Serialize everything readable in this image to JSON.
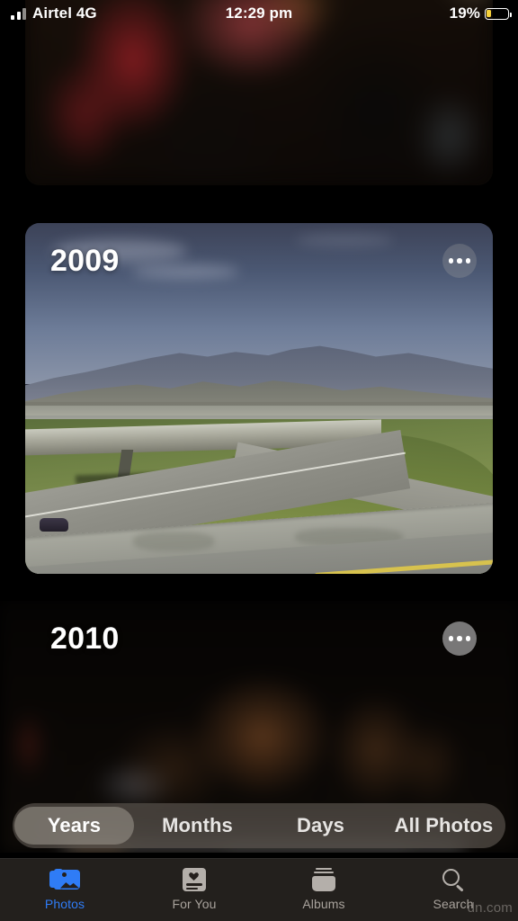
{
  "status_bar": {
    "carrier": "Airtel 4G",
    "time": "12:29 pm",
    "battery_percent": "19%",
    "battery_level": 19,
    "signal_icon": "signal-bars-icon",
    "battery_icon": "battery-low-icon",
    "battery_color": "#f7d13a"
  },
  "app": {
    "name": "Photos",
    "screen": "Years"
  },
  "cards": [
    {
      "year": "",
      "more_label": "•••",
      "artwork": "dark-blurred-crowd",
      "visible": "partial-top"
    },
    {
      "year": "2009",
      "more_label": "•••",
      "artwork": "highway-overpass-mountains",
      "visible": "full"
    },
    {
      "year": "2010",
      "more_label": "•••",
      "artwork": "dark-night-scene",
      "visible": "partial-bottom"
    }
  ],
  "segmented_control": {
    "selected": "Years",
    "options": [
      {
        "label": "Years",
        "selected": true
      },
      {
        "label": "Months",
        "selected": false
      },
      {
        "label": "Days",
        "selected": false
      },
      {
        "label": "All Photos",
        "selected": false
      }
    ]
  },
  "tab_bar": {
    "active": "Photos",
    "active_color": "#2f7cf6",
    "inactive_color": "#a8a29c",
    "tabs": [
      {
        "label": "Photos",
        "icon": "photos-stack-icon",
        "active": true
      },
      {
        "label": "For You",
        "icon": "for-you-heart-card-icon",
        "active": false
      },
      {
        "label": "Albums",
        "icon": "albums-stack-icon",
        "active": false
      },
      {
        "label": "Search",
        "icon": "magnifying-glass-icon",
        "active": false
      }
    ]
  },
  "watermark": {
    "text": "dn.com"
  }
}
